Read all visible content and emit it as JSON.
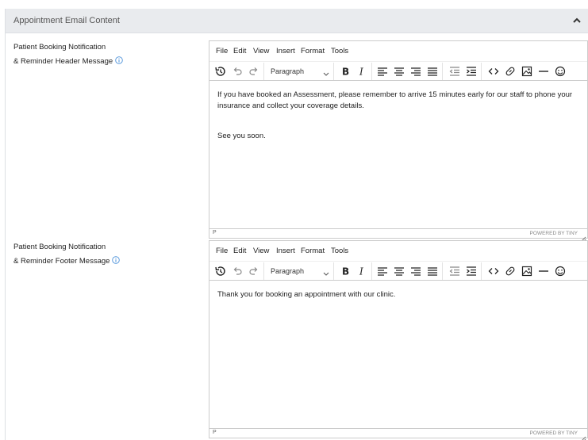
{
  "panel": {
    "title": "Appointment Email Content"
  },
  "fields": [
    {
      "label_line1": "Patient Booking Notification",
      "label_line2": "& Reminder Header Message",
      "editor": {
        "menu": [
          "File",
          "Edit",
          "View",
          "Insert",
          "Format",
          "Tools"
        ],
        "block_format": "Paragraph",
        "content": [
          "If you have booked an Assessment, please remember to arrive 15 minutes early for our staff to phone your insurance and collect your coverage details.",
          "See you soon."
        ],
        "path": "P",
        "brand": "POWERED BY TINY"
      }
    },
    {
      "label_line1": "Patient Booking Notification",
      "label_line2": "& Reminder Footer Message",
      "editor": {
        "menu": [
          "File",
          "Edit",
          "View",
          "Insert",
          "Format",
          "Tools"
        ],
        "block_format": "Paragraph",
        "content": [
          "Thank you for booking an appointment with our clinic."
        ],
        "path": "P",
        "brand": "POWERED BY TINY"
      }
    }
  ],
  "icons": {
    "collapse": "chevron-up-icon",
    "info": "info-icon",
    "toolbar": [
      "history-icon",
      "undo-icon",
      "redo-icon",
      "bold-icon",
      "italic-icon",
      "align-left-icon",
      "align-center-icon",
      "align-right-icon",
      "align-justify-icon",
      "outdent-icon",
      "indent-icon",
      "code-icon",
      "link-icon",
      "image-icon",
      "horizontal-rule-icon",
      "emoji-icon"
    ]
  },
  "colors": {
    "header_bg": "#e9ebee",
    "border": "#cccccc",
    "info_blue": "#4a90d9"
  }
}
